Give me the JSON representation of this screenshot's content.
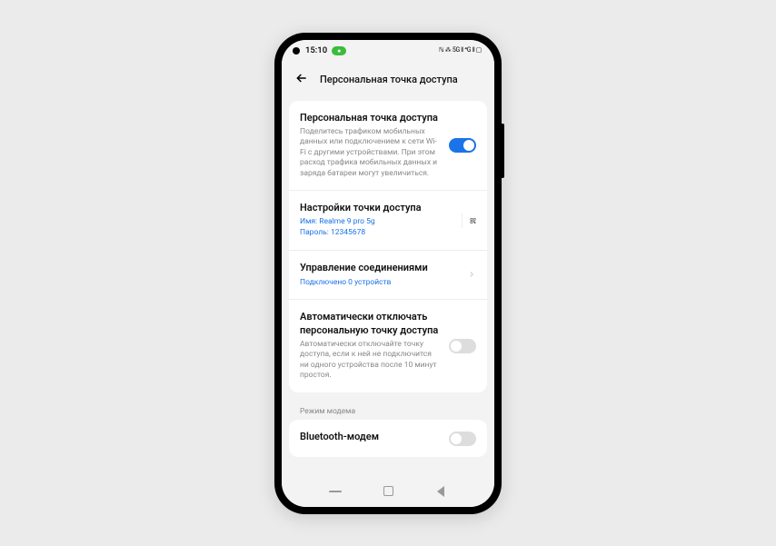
{
  "status": {
    "time": "15:10",
    "pill": "●",
    "icons": "ℕ ⁂ 5G ⫴ ⁴G ⫴ ▢"
  },
  "header": {
    "title": "Персональная точка доступа"
  },
  "hotspot": {
    "title": "Персональная точка доступа",
    "desc": "Поделитесь трафиком мобильных данных или подключением к сети Wi-Fi с другими устройствами. При этом расход трафика мобильных данных и заряда батареи могут увеличиться.",
    "on": true
  },
  "settings": {
    "title": "Настройки точки доступа",
    "name_label": "Имя:",
    "name_value": "Realme 9 pro 5g",
    "pass_label": "Пароль:",
    "pass_value": "12345678"
  },
  "connections": {
    "title": "Управление соединениями",
    "sub": "Подключено 0 устройств"
  },
  "auto_off": {
    "title": "Автоматически отключать персональную точку доступа",
    "desc": "Автоматически отключайте точку доступа, если к ней не подключится ни одного устройства после 10 минут простоя.",
    "on": false
  },
  "section": {
    "label": "Режим модема"
  },
  "bluetooth": {
    "title": "Bluetooth-модем",
    "on": false
  }
}
